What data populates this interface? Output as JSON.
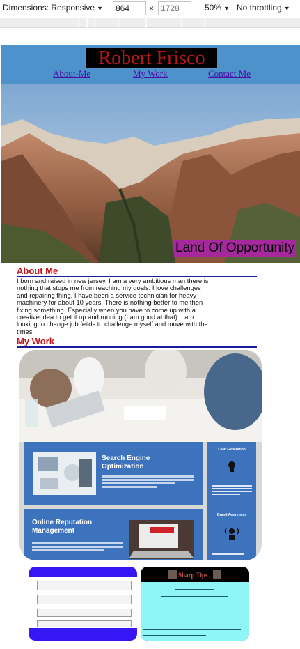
{
  "devtools": {
    "dimensions_label": "Dimensions: Responsive",
    "width": "864",
    "height": "1728",
    "times": "×",
    "zoom": "50%",
    "throttling": "No throttling"
  },
  "site": {
    "title": "Robert Frisco",
    "nav": [
      "About-Me",
      "My Work",
      "Contact Me"
    ],
    "hero_caption": "Land Of Opportunity",
    "about_heading": "About Me",
    "about_text": "I born and raised in new jersey. I am a very ambitious man there is nothing that stops me from reaching my goals. I love challenges and repairing thing. I have been a service technician for heavy machinery for about 10 years. There is nothing better to me then fixing something. Especially when you have to come up with a creative idea to get it up and running (I am good at that). I am looking to change job feilds to challenge myself and move with the times.",
    "work_heading": "My Work",
    "work_card_1_title": "Search Engine Optimization",
    "work_card_2_title": "Online Reputation Management",
    "side_card_1": "Lead Generation",
    "side_card_2": "Brand Awareness",
    "thumb2_title": "Sharp Tips"
  },
  "colors": {
    "header_bg": "#4e92cc",
    "title_red": "#b41919",
    "nav_purple": "#4b0fa8",
    "caption_bg": "#a5299c",
    "heading_red": "#c4151b",
    "rule_blue": "#1a1a9a",
    "card_blue": "#3d73bd",
    "thumb1_bg": "#3616f2",
    "thumb2_bg": "#8ef6f6"
  }
}
